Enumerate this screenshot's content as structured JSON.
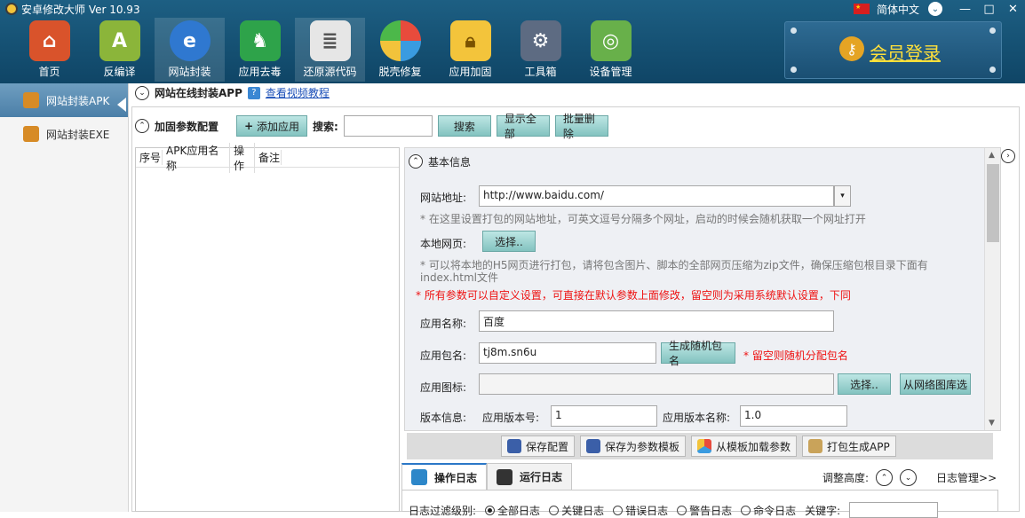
{
  "app": {
    "title": "安卓修改大师 Ver 10.93",
    "language": "简体中文"
  },
  "toolbar": [
    {
      "label": "首页",
      "icon": "home-icon",
      "color": "#d9532b"
    },
    {
      "label": "反编译",
      "icon": "android-icon",
      "color": "#8bb53a"
    },
    {
      "label": "网站封装",
      "icon": "ie-icon",
      "color": "#2f78d0"
    },
    {
      "label": "应用去毒",
      "icon": "shield-icon",
      "color": "#2ea34a"
    },
    {
      "label": "还原源代码",
      "icon": "document-icon",
      "color": "#e6e6e6"
    },
    {
      "label": "脱壳修复",
      "icon": "globe-icon",
      "color": "#f2a03b"
    },
    {
      "label": "应用加固",
      "icon": "lock-icon",
      "color": "#f3c43b"
    },
    {
      "label": "工具箱",
      "icon": "toolbox-icon",
      "color": "#5d6b82"
    },
    {
      "label": "设备管理",
      "icon": "radar-icon",
      "color": "#68b04a"
    }
  ],
  "member": {
    "label": "会员登录"
  },
  "sidebar": {
    "items": [
      {
        "label": "网站封装APK"
      },
      {
        "label": "网站封装EXE"
      }
    ]
  },
  "header": {
    "title": "网站在线封装APP",
    "help_link": "查看视频教程"
  },
  "config": {
    "title": "加固参数配置",
    "add_app": "添加应用",
    "search_label": "搜索:",
    "search_value": "",
    "search_btn": "搜索",
    "show_all": "显示全部",
    "batch_delete": "批量删除"
  },
  "list_headers": [
    "序号",
    "APK应用名称",
    "操作",
    "备注"
  ],
  "basic": {
    "section_title": "基本信息",
    "site_label": "网站地址:",
    "site_value": "http://www.baidu.com/",
    "site_hint": "* 在这里设置打包的网站地址，可英文逗号分隔多个网址，启动的时候会随机获取一个网址打开",
    "local_label": "本地网页:",
    "select_btn": "选择..",
    "local_hint_1": "* 可以将本地的H5网页进行打包，请将包含图片、脚本的全部网页压缩为zip文件，确保压缩包根目录下面有",
    "local_hint_2": "index.html文件",
    "red_note": "* 所有参数可以自定义设置，可直接在默认参数上面修改，留空则为采用系统默认设置，下同",
    "name_label": "应用名称:",
    "name_value": "百度",
    "pkg_label": "应用包名:",
    "pkg_value": "tj8m.sn6u",
    "gen_pkg": "生成随机包名",
    "pkg_note": "* 留空则随机分配包名",
    "icon_label": "应用图标:",
    "icon_value": "",
    "icon_select": "选择..",
    "icon_from_net": "从网络图库选",
    "ver_label": "版本信息:",
    "ver_code_label": "应用版本号:",
    "ver_code_value": "1",
    "ver_name_label": "应用版本名称:",
    "ver_name_value": "1.0"
  },
  "actions": [
    "保存配置",
    "保存为参数模板",
    "从模板加载参数",
    "打包生成APP"
  ],
  "log": {
    "tab_ops": "操作日志",
    "tab_run": "运行日志",
    "adjust_height": "调整高度:",
    "log_manage": "日志管理>>",
    "filter_label": "日志过滤级别:",
    "filters": [
      "全部日志",
      "关键日志",
      "错误日志",
      "警告日志",
      "命令日志"
    ],
    "keyword_label": "关键字:"
  }
}
